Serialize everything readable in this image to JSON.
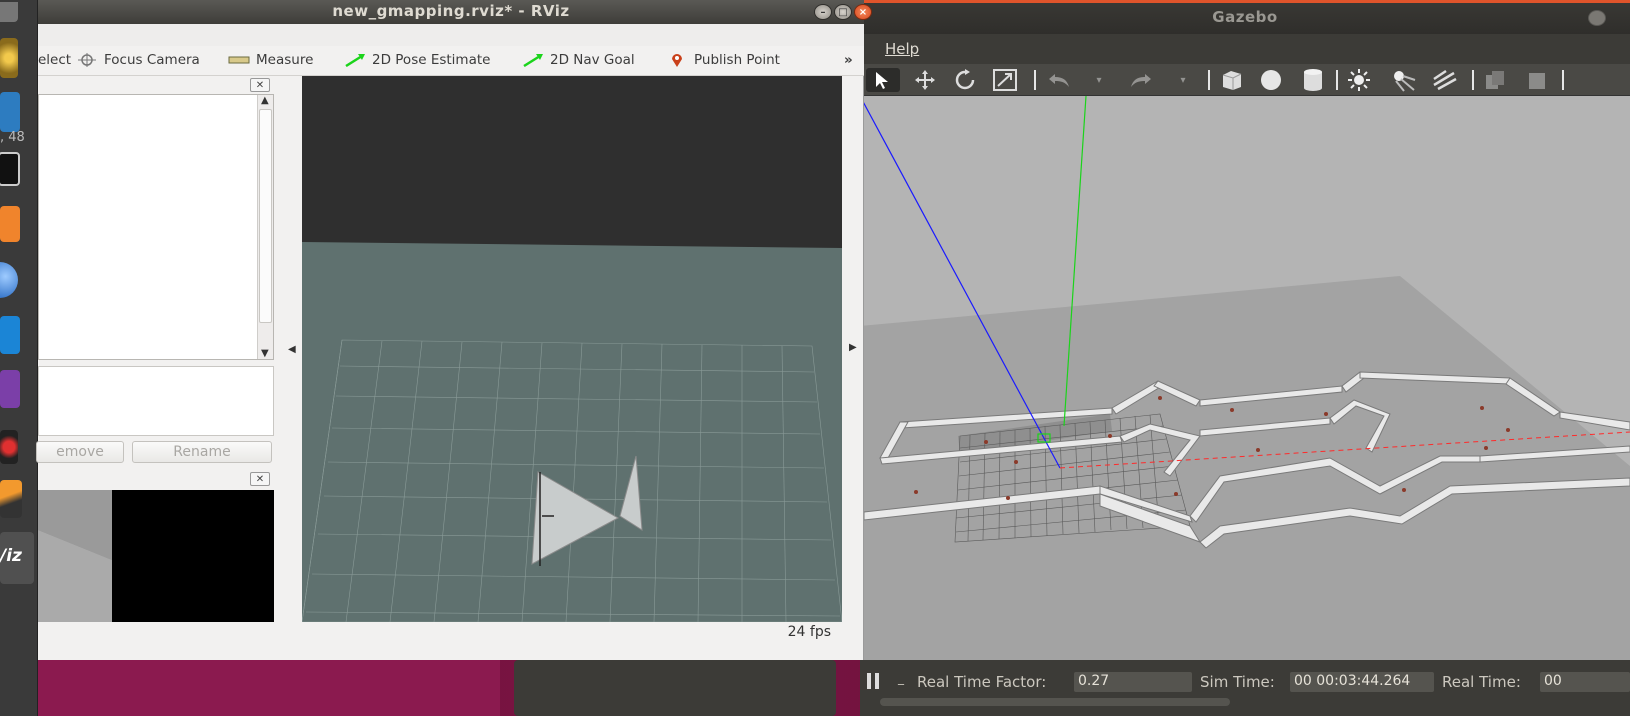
{
  "rviz": {
    "title": "new_gmapping.rviz* - RViz",
    "toolbar": {
      "select_partial": "elect",
      "focus_camera": "Focus Camera",
      "measure": "Measure",
      "pose_estimate": "2D Pose Estimate",
      "nav_goal": "2D Nav Goal",
      "publish_point": "Publish Point",
      "overflow": "»"
    },
    "buttons": {
      "remove_partial": "emove",
      "rename": "Rename"
    },
    "fps": "24 fps"
  },
  "gazebo": {
    "title": "Gazebo",
    "menu": {
      "help": "Help"
    },
    "status": {
      "rtf_label": "Real Time Factor:",
      "rtf_value": "0.27",
      "sim_time_label": "Sim Time:",
      "sim_time_value": "00 00:03:44.264",
      "real_time_label": "Real Time:",
      "real_time_value": "00"
    }
  },
  "dock": {
    "partial_label_1": ", 48",
    "partial_label_2": "/iz"
  },
  "colors": {
    "rviz_background": "#f2f1f0",
    "gazebo_scene": "#b7b7b7",
    "rviz_floor": "#5f716f",
    "accent_green": "#1bd41b",
    "axis_blue": "#1a1aff",
    "axis_red": "#ff2a2a"
  }
}
